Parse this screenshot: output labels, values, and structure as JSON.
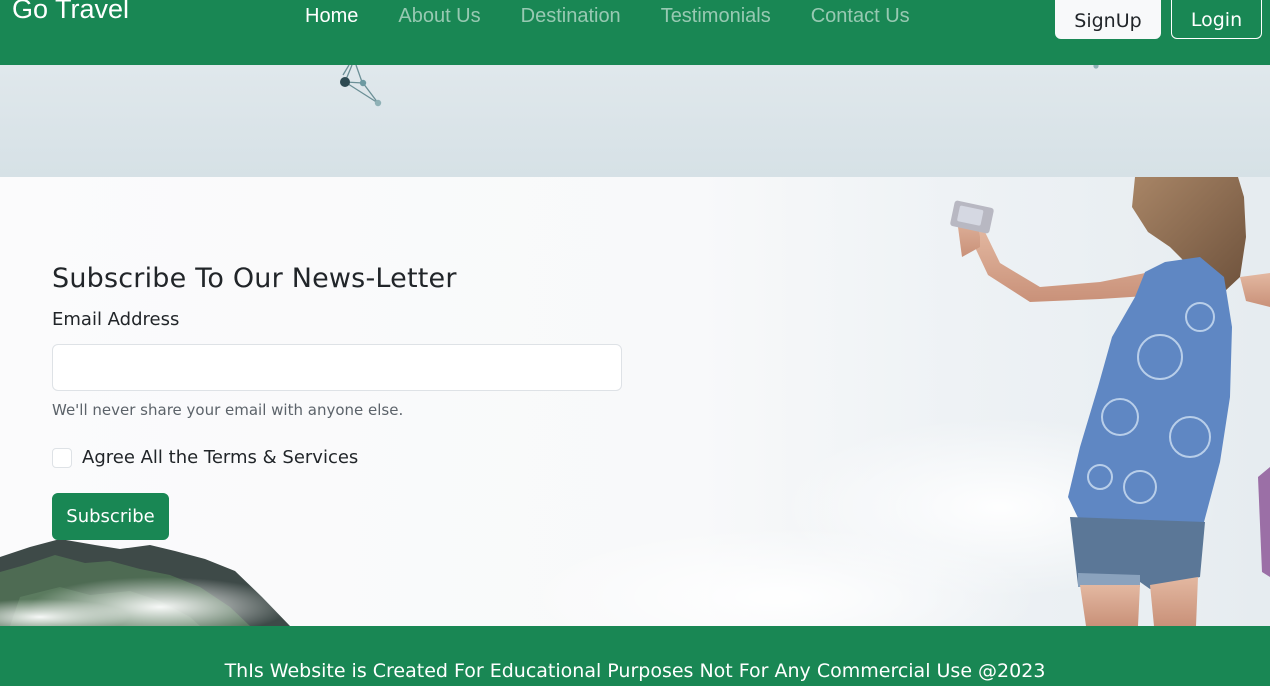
{
  "navbar": {
    "brand": "Go Travel",
    "links": [
      {
        "label": "Home",
        "active": true
      },
      {
        "label": "About Us",
        "active": false
      },
      {
        "label": "Destination",
        "active": false
      },
      {
        "label": "Testimonials",
        "active": false
      },
      {
        "label": "Contact Us",
        "active": false
      }
    ],
    "signup_label": "SignUp",
    "login_label": "Login"
  },
  "newsletter": {
    "title": "Subscribe To Our News-Letter",
    "email_label": "Email Address",
    "email_value": "",
    "email_placeholder": "",
    "help_text": "We'll never share your email with anyone else.",
    "agree_label": "Agree All the Terms & Services",
    "agree_checked": false,
    "subscribe_label": "Subscribe"
  },
  "footer": {
    "text": "ThIs Website is Created For Educational Purposes Not For Any Commercial Use @2023"
  },
  "colors": {
    "primary": "#198754",
    "text": "#212529",
    "muted": "#5c636a"
  },
  "icons": {
    "hero_decoration": "hanging-ornament-icon",
    "background_art": "travel-photo-illustration"
  }
}
